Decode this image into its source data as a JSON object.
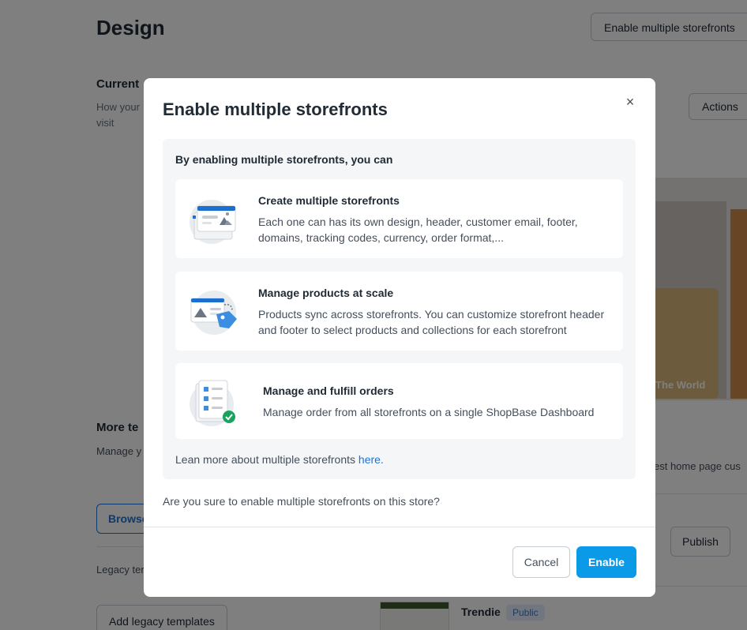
{
  "background": {
    "page_title": "Design",
    "enable_multiple_storefronts_button": "Enable multiple storefronts",
    "current_heading": "Current",
    "current_sub": "How your visit",
    "actions_label": "Actions",
    "more_heading": "More te",
    "more_desc": "Manage y publish w store's ap",
    "browse_label": "Browse",
    "legacy_desc": "Legacy ter using the",
    "add_legacy_label": "Add legacy templates",
    "best_home_line": "est home page cus",
    "publish_label": "Publish",
    "template_name": "Trendie",
    "template_badge": "Public",
    "preview_text": "The World"
  },
  "modal": {
    "title": "Enable multiple storefronts",
    "close_symbol": "×",
    "intro": "By enabling multiple storefronts, you can",
    "features": [
      {
        "icon": "storefronts-icon",
        "title": "Create multiple storefronts",
        "description": "Each one can has its own design, header, customer email, footer, domains, tracking codes, currency, order format,..."
      },
      {
        "icon": "products-tag-icon",
        "title": "Manage products at scale",
        "description": "Products sync across storefronts. You can customize storefront header and footer to select products and collections for each storefront"
      },
      {
        "icon": "orders-check-icon",
        "title": "Manage and fulfill orders",
        "description": "Manage order from all storefronts on a single ShopBase Dashboard"
      }
    ],
    "learn_more_prefix": "Lean more about multiple storefronts ",
    "learn_more_link": "here.",
    "confirm_question": "Are you sure to enable multiple storefronts on this store?",
    "cancel_label": "Cancel",
    "enable_label": "Enable"
  },
  "colors": {
    "primary": "#0b9ae8",
    "link": "#1a73d9",
    "overlay": "rgba(0,0,0,0.5)"
  }
}
